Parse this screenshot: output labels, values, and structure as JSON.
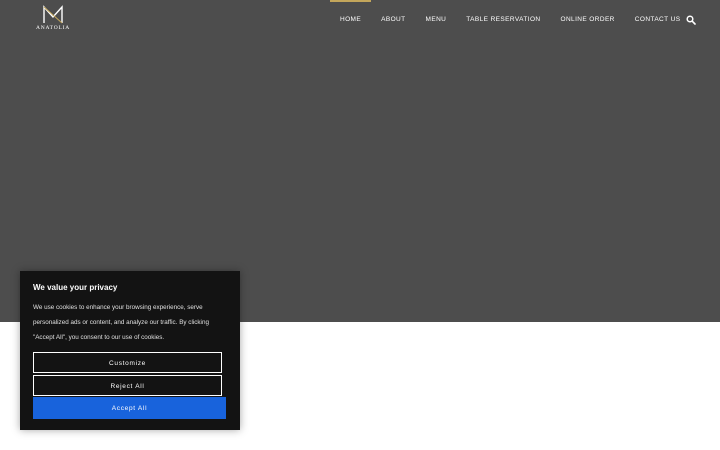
{
  "brand": {
    "name": "ANATOLIA"
  },
  "nav": {
    "items": [
      {
        "label": "HOME",
        "active": true
      },
      {
        "label": "ABOUT"
      },
      {
        "label": "MENU"
      },
      {
        "label": "TABLE RESERVATION"
      },
      {
        "label": "ONLINE ORDER"
      },
      {
        "label": "CONTACT US"
      }
    ],
    "search_icon": "search-icon"
  },
  "cookie_banner": {
    "title": "We value your privacy",
    "text": "We use cookies to enhance your browsing experience, serve personalized ads or content, and analyze our traffic. By clicking \"Accept All\", you consent to our use of cookies.",
    "customize_label": "Customize",
    "reject_label": "Reject All",
    "accept_label": "Accept All"
  },
  "colors": {
    "hero_bg": "#4d4d4d",
    "accent": "#c3a65b",
    "accept_button": "#1863dc",
    "banner_bg": "#131313"
  }
}
